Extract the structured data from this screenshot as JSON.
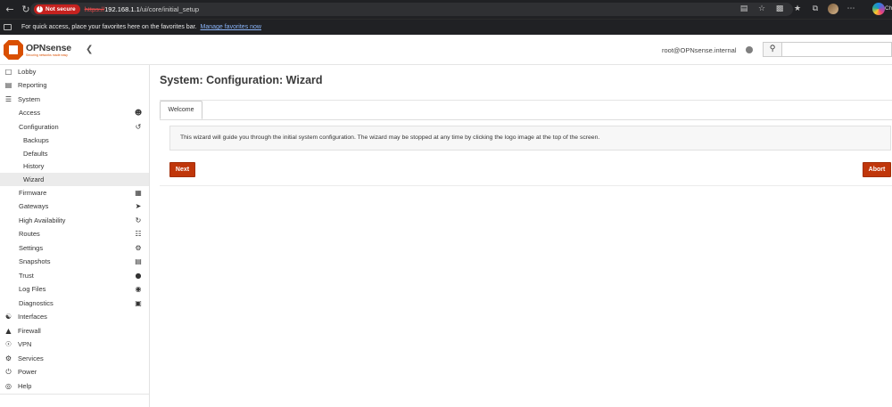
{
  "browser": {
    "not_secure_label": "Not secure",
    "url_scheme": "https://",
    "url_host": "192.168.1.1",
    "url_path": "/ui/core/initial_setup",
    "favorites_text": "For quick access, place your favorites here on the favorites bar.",
    "favorites_link": "Manage favorites now",
    "profile_text": "Che"
  },
  "header": {
    "logo_name": "OPNsense",
    "logo_tagline": "Securing networks made easy",
    "user": "root@OPNsense.internal",
    "search_placeholder": ""
  },
  "sidebar": {
    "items": [
      {
        "label": "Lobby",
        "icon": "laptop-icon"
      },
      {
        "label": "Reporting",
        "icon": "chart-icon"
      },
      {
        "label": "System",
        "icon": "server-icon"
      },
      {
        "label": "Access",
        "icon": "users-icon"
      },
      {
        "label": "Configuration",
        "icon": "history-icon"
      },
      {
        "label": "Backups"
      },
      {
        "label": "Defaults"
      },
      {
        "label": "History"
      },
      {
        "label": "Wizard"
      },
      {
        "label": "Firmware",
        "icon": "firmware-icon"
      },
      {
        "label": "Gateways",
        "icon": "location-arrow-icon"
      },
      {
        "label": "High Availability",
        "icon": "refresh-icon"
      },
      {
        "label": "Routes",
        "icon": "signpost-icon"
      },
      {
        "label": "Settings",
        "icon": "cogs-icon"
      },
      {
        "label": "Snapshots",
        "icon": "hdd-icon"
      },
      {
        "label": "Trust",
        "icon": "certificate-icon"
      },
      {
        "label": "Log Files",
        "icon": "eye-icon"
      },
      {
        "label": "Diagnostics",
        "icon": "medkit-icon"
      },
      {
        "label": "Interfaces",
        "icon": "sitemap-icon"
      },
      {
        "label": "Firewall",
        "icon": "fire-icon"
      },
      {
        "label": "VPN",
        "icon": "globe-icon"
      },
      {
        "label": "Services",
        "icon": "cog-icon"
      },
      {
        "label": "Power",
        "icon": "plug-icon"
      },
      {
        "label": "Help",
        "icon": "lifebuoy-icon"
      }
    ]
  },
  "main": {
    "title": "System: Configuration: Wizard",
    "tab_label": "Welcome",
    "message": "This wizard will guide you through the initial system configuration. The wizard may be stopped at any time by clicking the logo image at the top of the screen.",
    "next_label": "Next",
    "abort_label": "Abort"
  }
}
